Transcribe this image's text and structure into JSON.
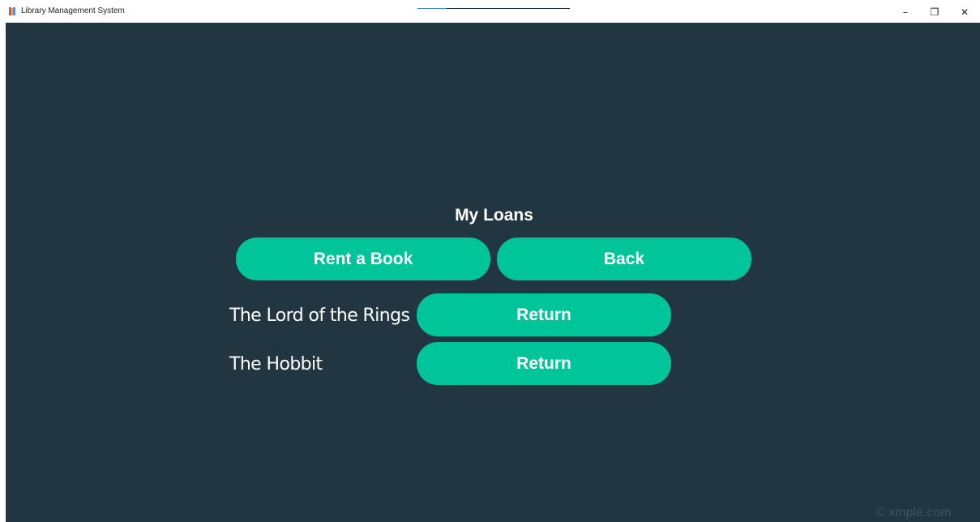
{
  "window": {
    "title": "Library Management System",
    "controls": {
      "minimize": "–",
      "maximize": "❐",
      "close": "✕"
    }
  },
  "main": {
    "title": "My Loans",
    "actions": {
      "rent_label": "Rent a Book",
      "back_label": "Back"
    },
    "loans": [
      {
        "title": "The Lord of the Rings",
        "action_label": "Return"
      },
      {
        "title": "The Hobbit",
        "action_label": "Return"
      }
    ]
  },
  "watermark": "© xmple.com",
  "colors": {
    "background": "#213640",
    "button": "#00c49a",
    "text": "#ffffff"
  },
  "icons": {
    "app": "book-stack-icon"
  }
}
